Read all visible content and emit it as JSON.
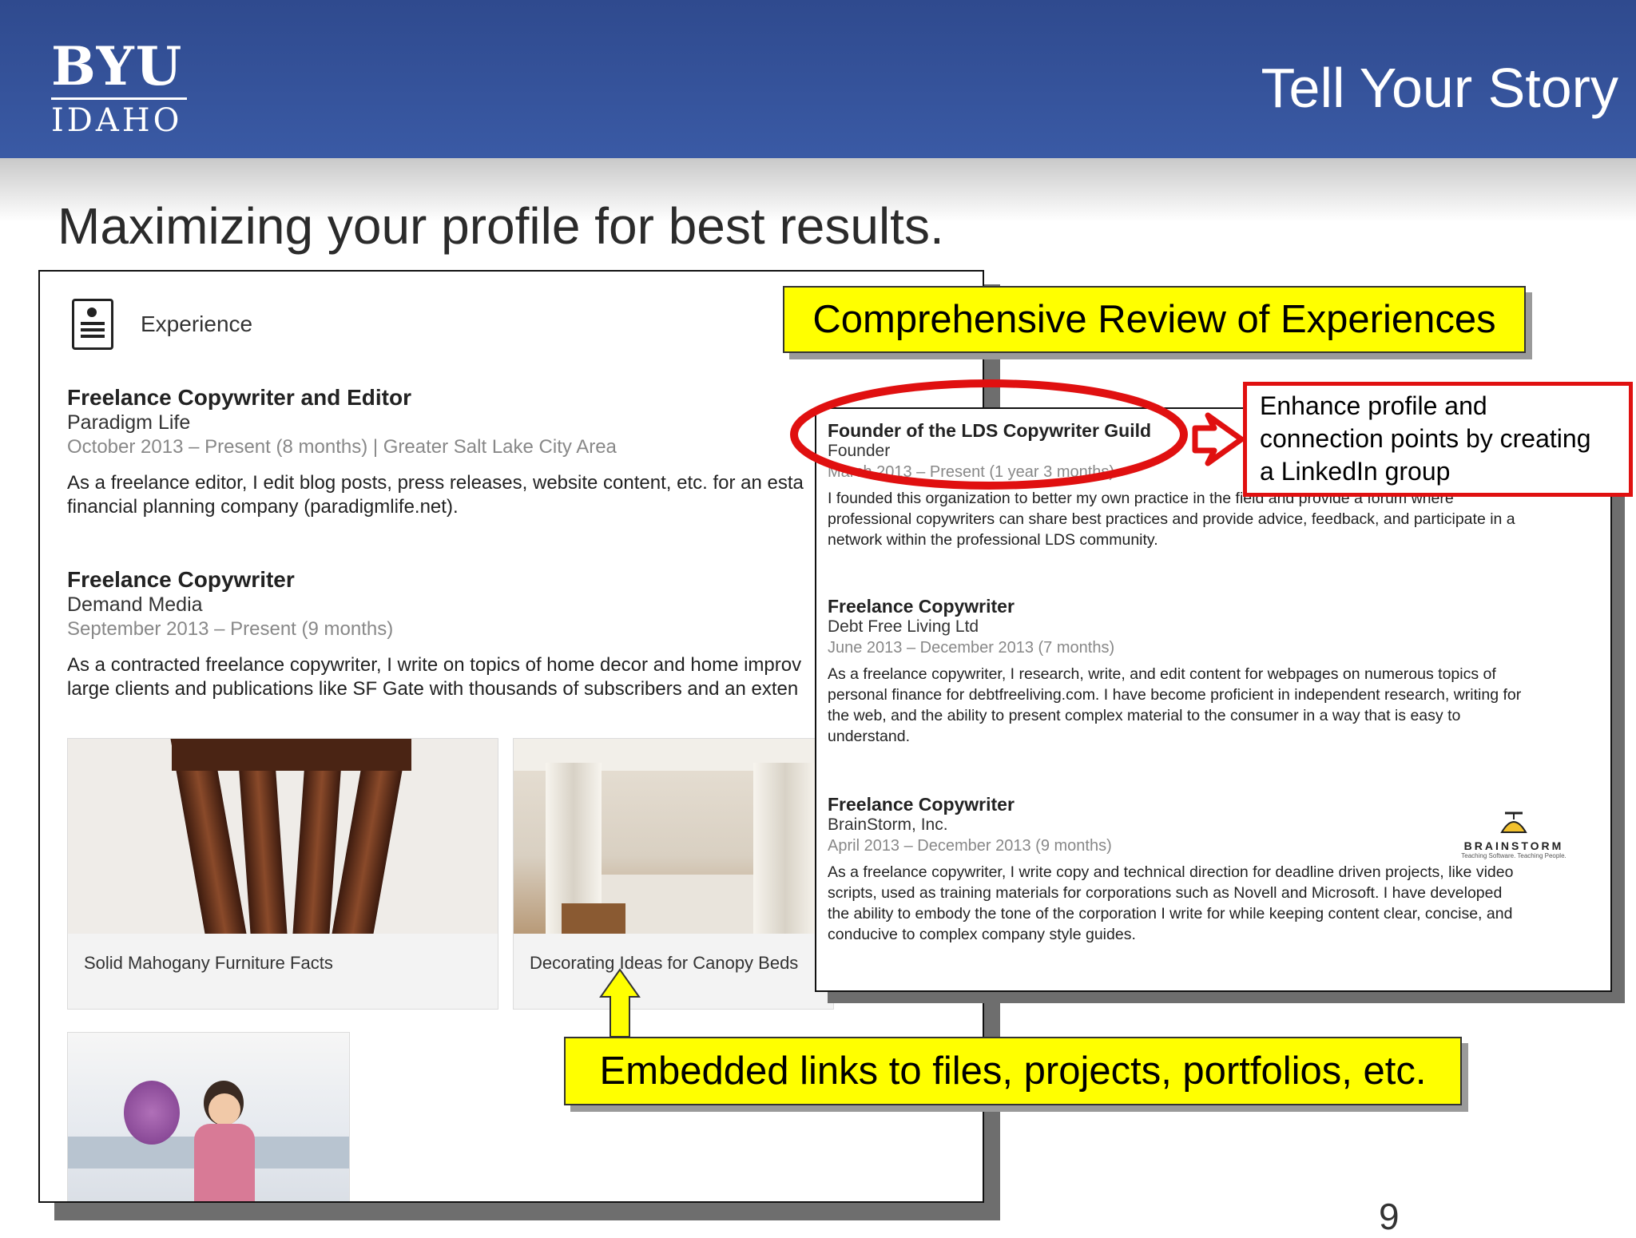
{
  "header": {
    "logo_top": "BYU",
    "logo_bottom": "IDAHO",
    "slide_title": "Tell Your Story"
  },
  "subtitle": "Maximizing your profile for best results.",
  "left_panel": {
    "section_heading": "Experience",
    "jobs": [
      {
        "title": "Freelance Copywriter and Editor",
        "company": "Paradigm Life",
        "dates": "October 2013 – Present (8 months)  |  Greater Salt Lake City Area",
        "description": "As a freelance editor, I edit blog posts, press releases, website content, etc. for an esta\nfinancial planning company (paradigmlife.net)."
      },
      {
        "title": "Freelance Copywriter",
        "company": "Demand Media",
        "dates": "September 2013 – Present (9 months)",
        "description": "As a contracted freelance copywriter, I write on topics of home decor and home improv\nlarge clients and publications like SF Gate with thousands of subscribers and an exten"
      }
    ],
    "cards": [
      {
        "caption": "Solid Mahogany Furniture Facts",
        "icon": "mahogany-furniture-image"
      },
      {
        "caption": "Decorating Ideas for Canopy Beds",
        "icon": "canopy-bed-image"
      },
      {
        "caption": "",
        "icon": "child-with-flowers-image"
      }
    ]
  },
  "right_panel": {
    "jobs": [
      {
        "title": "Founder of the LDS Copywriter Guild",
        "company": "Founder",
        "dates": "March 2013 – Present (1 year 3 months)",
        "description": "I founded this organization to better my own practice in the field and provide a forum where\nprofessional copywriters can share best practices and provide advice, feedback, and participate in a\nnetwork within the professional LDS community."
      },
      {
        "title": "Freelance Copywriter",
        "company": "Debt Free Living Ltd",
        "dates": "June 2013 – December 2013 (7 months)",
        "description": "As a freelance copywriter, I research, write, and edit content for webpages on numerous topics of\npersonal finance for debtfreeliving.com. I have become proficient in independent research, writing for\nthe web, and the ability to present complex material to the consumer in a way that is easy to\nunderstand."
      },
      {
        "title": "Freelance Copywriter",
        "company": "BrainStorm, Inc.",
        "dates": "April 2013 – December 2013 (9 months)",
        "description": "As a freelance copywriter, I write copy and technical direction for deadline driven projects, like video\nscripts, used as training materials for corporations such as Novell and Microsoft. I have developed\nthe ability to embody the tone of the corporation I write for while keeping content clear, concise, and\nconducive to complex company style guides."
      }
    ],
    "brainstorm_logo": {
      "word": "BRAINSTORM",
      "tagline": "Teaching Software. Teaching People."
    }
  },
  "callouts": {
    "top": "Comprehensive Review of Experiences",
    "right": "Enhance profile and\nconnection points by creating\na LinkedIn group",
    "bottom": "Embedded links to files, projects, portfolios, etc."
  },
  "page_number": "9",
  "colors": {
    "header_blue": "#3a5aa5",
    "callout_yellow": "#ffff00",
    "highlight_red": "#e01010"
  }
}
